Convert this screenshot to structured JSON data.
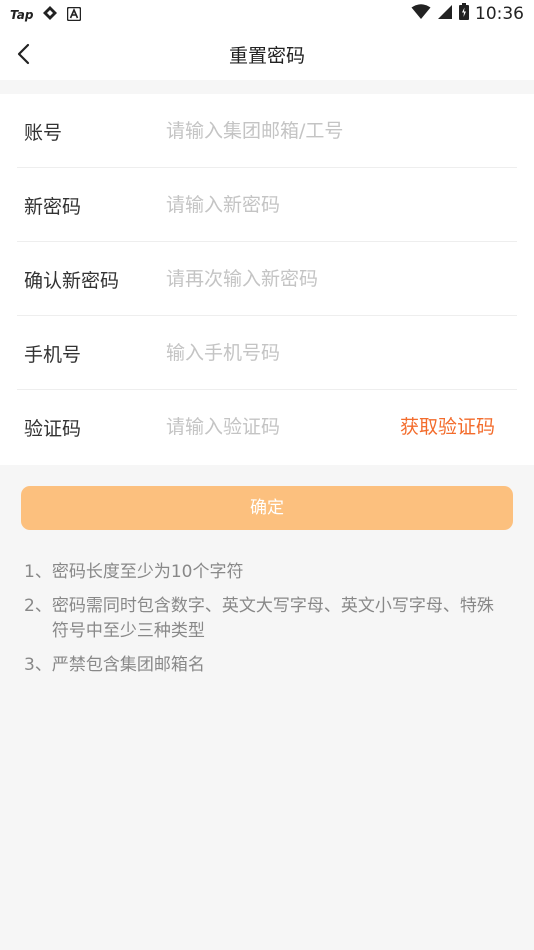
{
  "status_bar": {
    "carrier_label": "Tap",
    "time": "10:36"
  },
  "navbar": {
    "title": "重置密码"
  },
  "form": {
    "rows": [
      {
        "label": "账号",
        "placeholder": "请输入集团邮箱/工号"
      },
      {
        "label": "新密码",
        "placeholder": "请输入新密码"
      },
      {
        "label": "确认新密码",
        "placeholder": "请再次输入新密码"
      },
      {
        "label": "手机号",
        "placeholder": "输入手机号码"
      },
      {
        "label": "验证码",
        "placeholder": "请输入验证码"
      }
    ],
    "get_code_label": "获取验证码"
  },
  "confirm_label": "确定",
  "notes": [
    {
      "num": "1、",
      "text": "密码长度至少为10个字符"
    },
    {
      "num": "2、",
      "text": "密码需同时包含数字、英文大写字母、英文小写字母、特殊符号中至少三种类型"
    },
    {
      "num": "3、",
      "text": "严禁包含集团邮箱名"
    }
  ],
  "colors": {
    "accent": "#f36c2c",
    "confirm_bg": "#fcc07e",
    "page_bg": "#f6f6f6"
  }
}
